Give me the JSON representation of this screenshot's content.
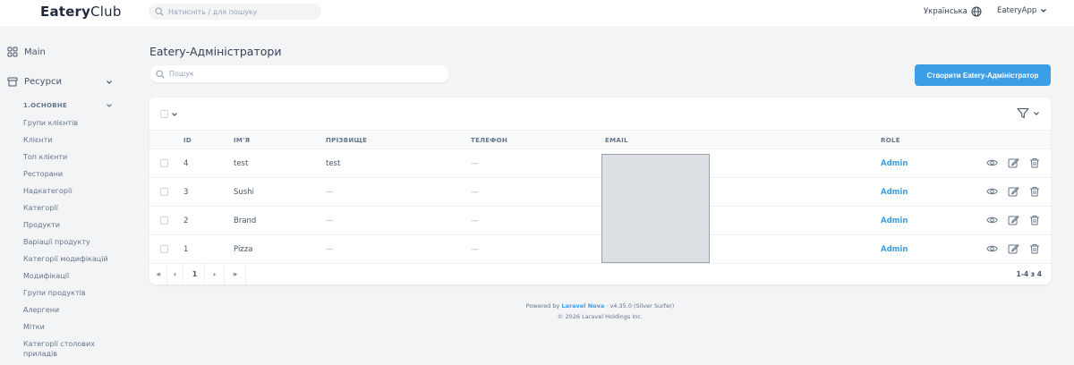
{
  "header": {
    "logo_bold": "Eatery",
    "logo_rest": "Club",
    "search_placeholder": "Натисніть / для пошуку",
    "language": "Українська",
    "user_menu": "EateryApp"
  },
  "sidebar": {
    "main_label": "Main",
    "resources_label": "Ресурси",
    "group_label": "1.ОСНОВНЕ",
    "items": [
      "Групи клієнтів",
      "Клієнти",
      "Топ клієнти",
      "Ресторани",
      "Надкатегорії",
      "Категорії",
      "Продукти",
      "Варіації продукту",
      "Категорії модифікацій",
      "Модифікації",
      "Групи продуктів",
      "Алергени",
      "Мітки"
    ],
    "last_item_line1": "Категорії столових",
    "last_item_line2": "приладів"
  },
  "main": {
    "title": "Eatery-Адміністратори",
    "search_placeholder": "Пошук",
    "create_button": "Створити Eatery-Адміністратор",
    "columns": [
      "ID",
      "ІМ'Я",
      "ПРІЗВИЩЕ",
      "ТЕЛЕФОН",
      "EMAIL",
      "ROLE"
    ],
    "rows": [
      {
        "id": "4",
        "name": "test",
        "surname": "test",
        "phone": "—",
        "role": "Admin"
      },
      {
        "id": "3",
        "name": "Sushi",
        "surname": "—",
        "phone": "—",
        "role": "Admin"
      },
      {
        "id": "2",
        "name": "Brand",
        "surname": "—",
        "phone": "—",
        "role": "Admin"
      },
      {
        "id": "1",
        "name": "Pizza",
        "surname": "—",
        "phone": "—",
        "role": "Admin"
      }
    ],
    "pagination": {
      "first": "«",
      "prev": "‹",
      "current": "1",
      "next": "›",
      "last": "»",
      "count": "1-4 з 4"
    }
  },
  "footer": {
    "powered_prefix": "Powered by",
    "link": "Laravel Nova",
    "version": "· v4.35.0 (Silver Surfer)",
    "copyright": "© 2026 Laravel Holdings Inc."
  },
  "colors": {
    "accent": "#3b9ee6",
    "background": "#f3f4f6"
  }
}
